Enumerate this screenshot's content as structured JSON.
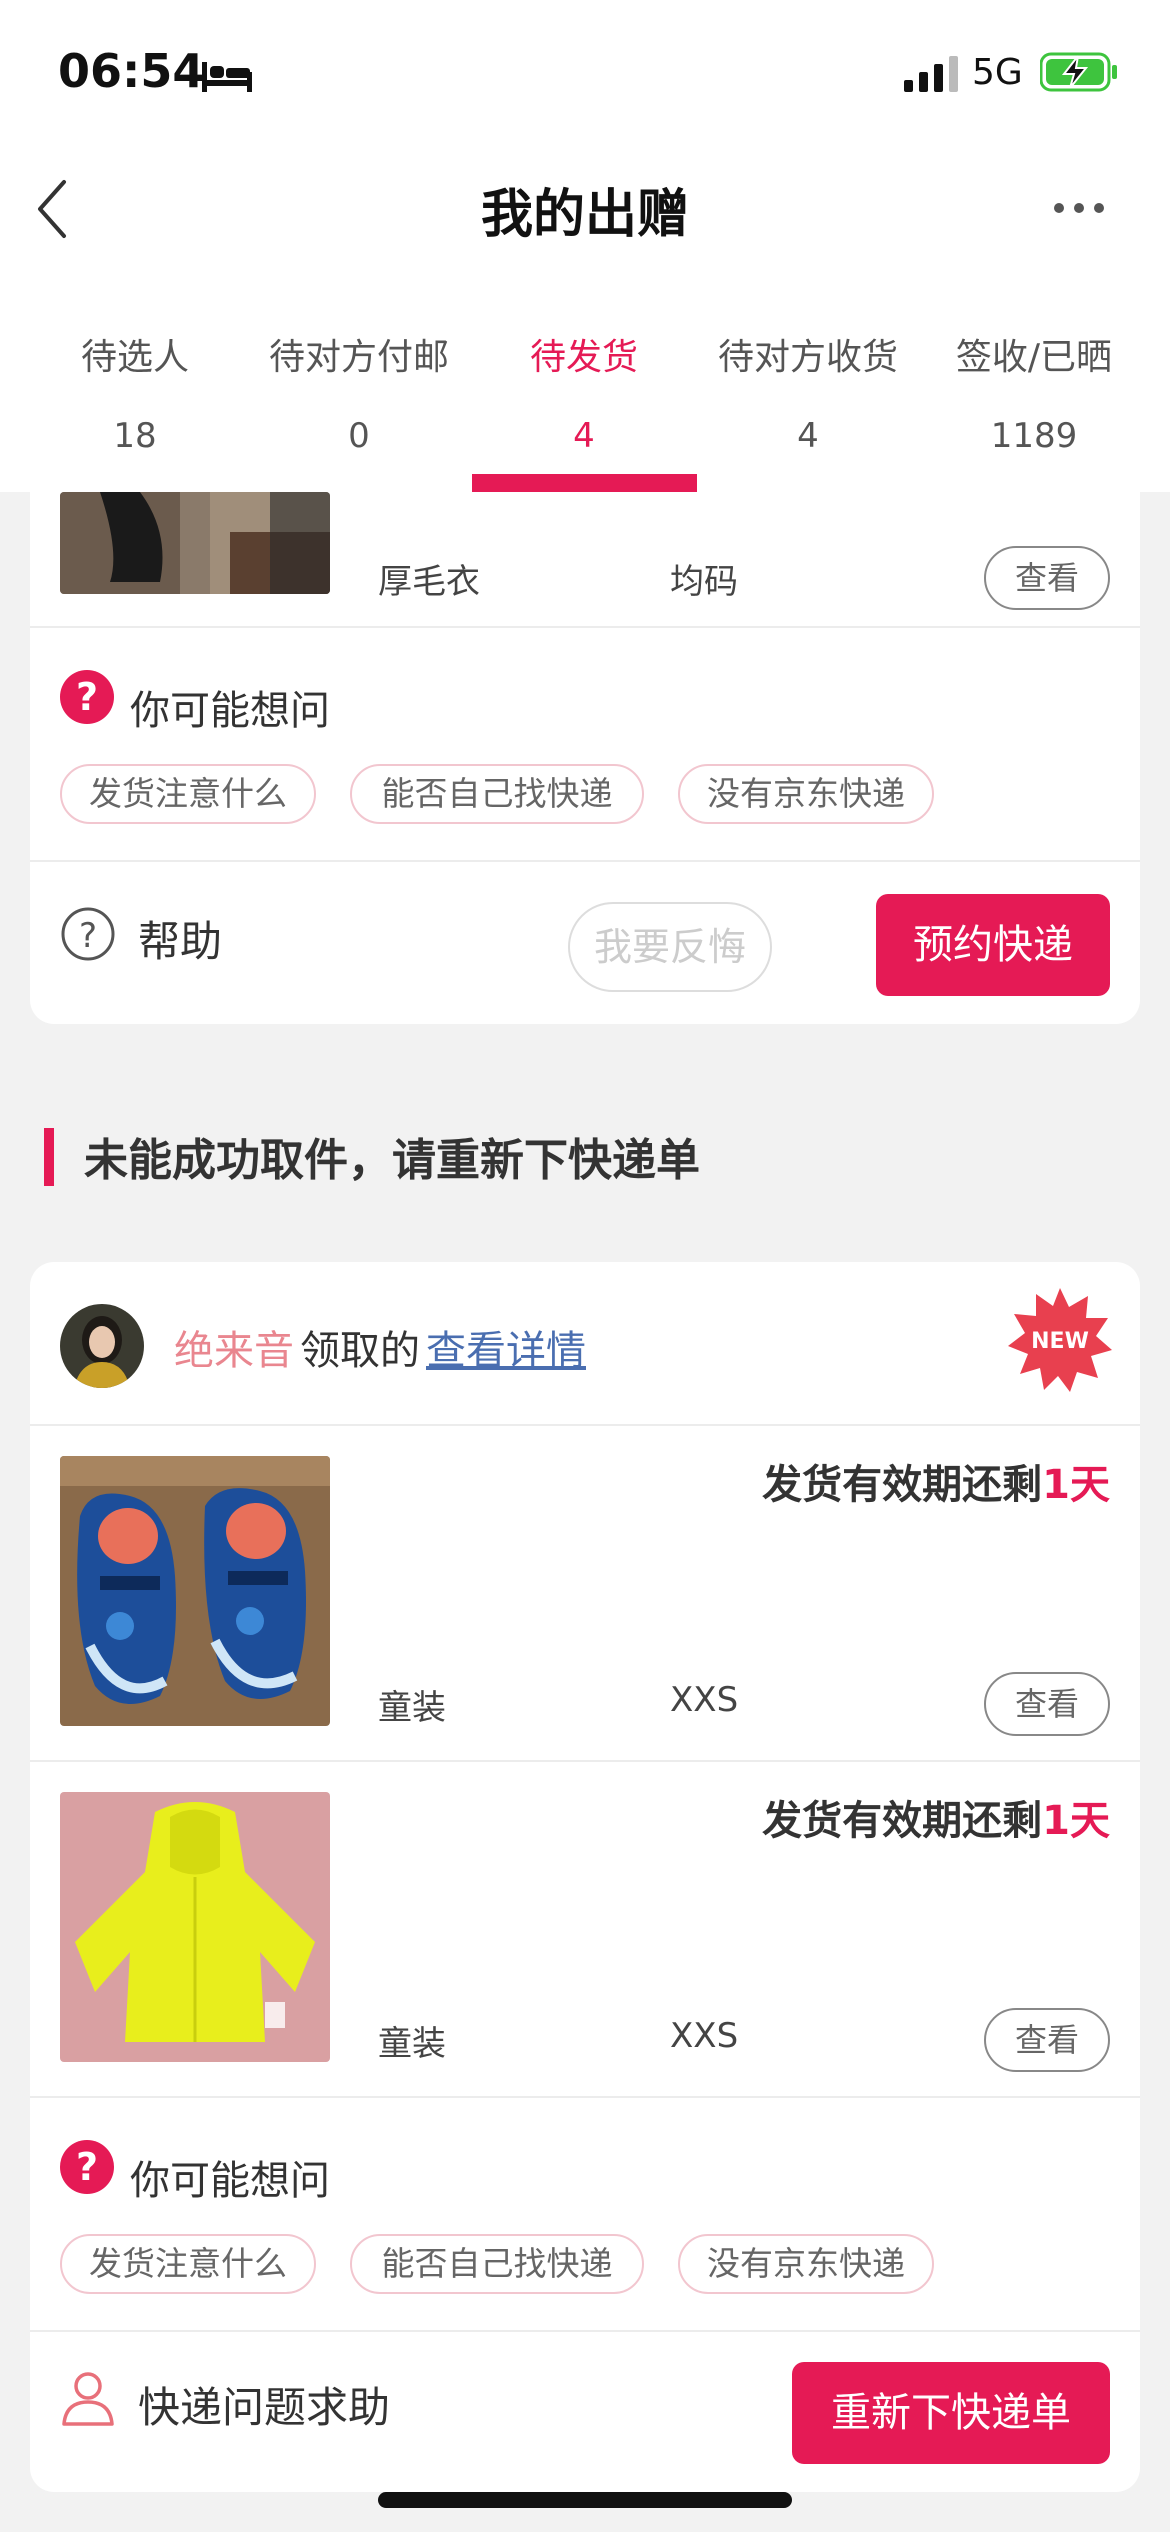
{
  "status_bar": {
    "time": "06:54",
    "network": "5G"
  },
  "nav": {
    "title": "我的出赠"
  },
  "tabs": [
    {
      "label": "待选人",
      "count": "18"
    },
    {
      "label": "待对方付邮",
      "count": "0"
    },
    {
      "label": "待发货",
      "count": "4",
      "active": true
    },
    {
      "label": "待对方收货",
      "count": "4"
    },
    {
      "label": "签收/已晒",
      "count": "1189"
    }
  ],
  "card1": {
    "item": {
      "name": "厚毛衣",
      "size": "均码",
      "view_label": "查看"
    },
    "faq": {
      "title": "你可能想问",
      "chips": [
        "发货注意什么",
        "能否自己找快递",
        "没有京东快递"
      ]
    },
    "footer": {
      "help_label": "帮助",
      "regret_label": "我要反悔",
      "primary_label": "预约快递"
    }
  },
  "section": {
    "title": "未能成功取件，请重新下快递单"
  },
  "card2": {
    "claimer": {
      "name": "绝来音",
      "text": "领取的",
      "link": "查看详情",
      "badge": "NEW"
    },
    "items": [
      {
        "deadline_prefix": "发货有效期还剩",
        "deadline_value": "1天",
        "name": "童装",
        "size": "XXS",
        "view_label": "查看"
      },
      {
        "deadline_prefix": "发货有效期还剩",
        "deadline_value": "1天",
        "name": "童装",
        "size": "XXS",
        "view_label": "查看"
      }
    ],
    "faq": {
      "title": "你可能想问",
      "chips": [
        "发货注意什么",
        "能否自己找快递",
        "没有京东快递"
      ]
    },
    "footer": {
      "help_label": "快递问题求助",
      "primary_label": "重新下快递单"
    }
  },
  "colors": {
    "accent": "#e51a55",
    "name_pink": "#e9868f",
    "link_blue": "#4a6eb0",
    "battery_green": "#3ec43e"
  }
}
